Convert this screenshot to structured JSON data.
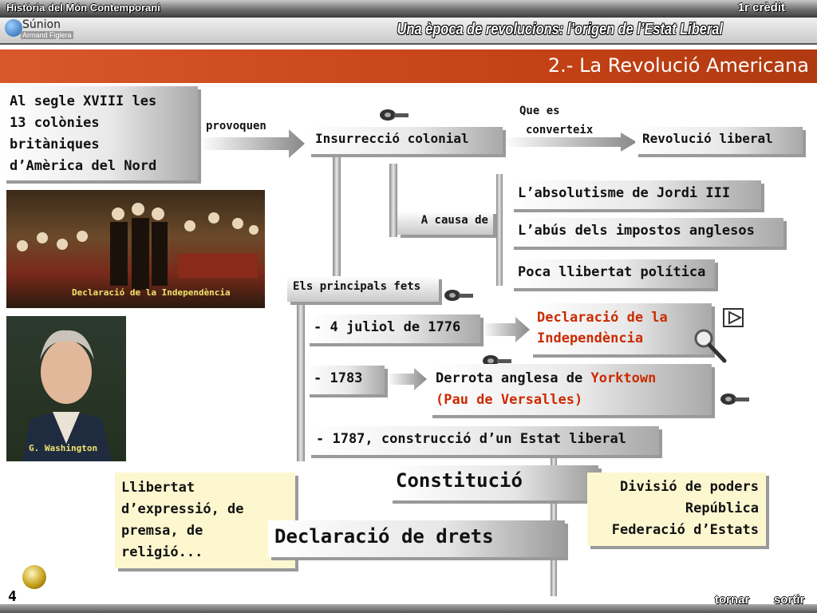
{
  "header": {
    "course": "Història del Món Contemporani",
    "credit": "1r crèdit",
    "logo_name": "Súnion",
    "logo_author": "Armand Figlera",
    "unit_title": "Una època de revolucions: l’origen de l’Estat Liberal"
  },
  "banner": {
    "title": "2.- La Revolució Americana"
  },
  "intro": {
    "line1": "Al segle XVIII les",
    "line2": "13 colònies",
    "line3": "britàniques",
    "line4": "d’Amèrica del Nord"
  },
  "connectors": {
    "provoquen": "provoquen",
    "que_es_1": "Que es",
    "que_es_2": "converteix",
    "a_causa_de": "A causa de",
    "principals_fets": "Els principals fets"
  },
  "insurrection": "Insurrecció colonial",
  "liberal": "Revolució liberal",
  "causes": [
    "L’absolutisme de Jordi III",
    "L’abús dels impostos anglesos",
    "Poca llibertat política"
  ],
  "events": {
    "e1776": "- 4 juliol de 1776",
    "decl_1": "Declaració de la",
    "decl_2": "Independència",
    "e1783": "- 1783",
    "derrota_a": "Derrota anglesa de ",
    "derrota_b": "Yorktown",
    "derrota_c": "(Pau de Versalles)",
    "e1787": "- 1787, construcció d’un Estat liberal"
  },
  "constitution": {
    "title": "Constitució",
    "items": [
      "Divisió de poders",
      "República",
      "Federació d’Estats"
    ]
  },
  "rights": {
    "title": "Declaració de drets",
    "l1": "Llibertat",
    "l2": "d’expressió, de",
    "l3": "premsa, de",
    "l4": "religió..."
  },
  "images": {
    "painting_caption": "Declaració de la Independència",
    "portrait_caption": "G. Washington"
  },
  "footer": {
    "page": "4",
    "back": "tornar",
    "exit": "sortir"
  },
  "colors": {
    "banner": "#c24014",
    "accent_red": "#cc2a00",
    "note_yellow": "#fdf7d0"
  }
}
